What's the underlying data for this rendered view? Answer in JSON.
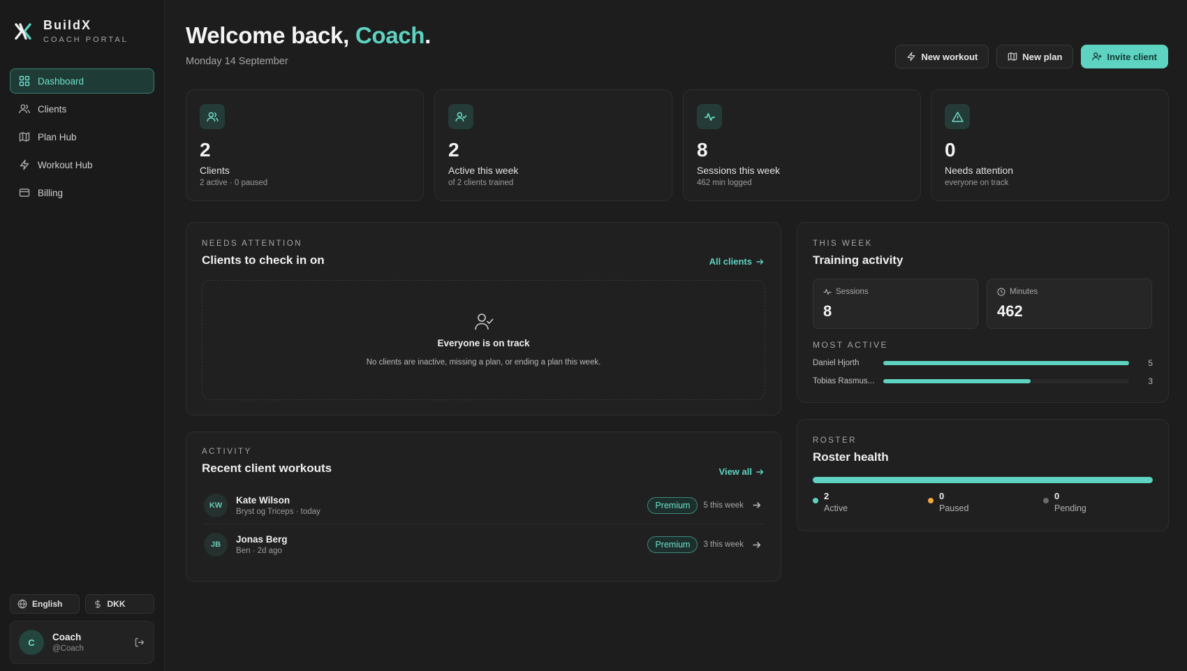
{
  "brand": {
    "name": "BuildX",
    "subtitle": "COACH PORTAL"
  },
  "sidebar": {
    "items": [
      {
        "label": "Dashboard",
        "icon": "grid-icon",
        "active": true
      },
      {
        "label": "Clients",
        "icon": "users-icon"
      },
      {
        "label": "Plan Hub",
        "icon": "map-icon"
      },
      {
        "label": "Workout Hub",
        "icon": "bolt-icon"
      },
      {
        "label": "Billing",
        "icon": "credit-card-icon"
      }
    ],
    "language": "English",
    "currency": "DKK",
    "user": {
      "initial": "C",
      "name": "Coach",
      "handle": "@Coach"
    }
  },
  "header": {
    "greeting": "Welcome back, ",
    "name": "Coach",
    "punct": ".",
    "date": "Monday 14 September",
    "actions": {
      "new_workout": "New workout",
      "new_plan": "New plan",
      "invite_client": "Invite client"
    }
  },
  "stats": [
    {
      "value": "2",
      "label": "Clients",
      "sub": "2 active · 0 paused",
      "icon": "users-icon"
    },
    {
      "value": "2",
      "label": "Active this week",
      "sub": "of 2 clients trained",
      "icon": "user-check-icon"
    },
    {
      "value": "8",
      "label": "Sessions this week",
      "sub": "462 min logged",
      "icon": "activity-icon"
    },
    {
      "value": "0",
      "label": "Needs attention",
      "sub": "everyone on track",
      "icon": "alert-triangle-icon"
    }
  ],
  "attention": {
    "eyebrow": "NEEDS ATTENTION",
    "title": "Clients to check in on",
    "link": "All clients",
    "empty_title": "Everyone is on track",
    "empty_sub": "No clients are inactive, missing a plan, or ending a plan this week."
  },
  "activity": {
    "eyebrow": "ACTIVITY",
    "title": "Recent client workouts",
    "link": "View all",
    "rows": [
      {
        "initials": "KW",
        "name": "Kate Wilson",
        "sub": "Bryst og Triceps · today",
        "badge": "Premium",
        "count": "5 this week"
      },
      {
        "initials": "JB",
        "name": "Jonas Berg",
        "sub": "Ben · 2d ago",
        "badge": "Premium",
        "count": "3 this week"
      }
    ]
  },
  "training": {
    "eyebrow": "THIS WEEK",
    "title": "Training activity",
    "sessions_label": "Sessions",
    "sessions_value": "8",
    "minutes_label": "Minutes",
    "minutes_value": "462",
    "most_active_label": "MOST ACTIVE",
    "most_active": [
      {
        "name": "Daniel Hjorth",
        "value": "5",
        "fraction": 1.0
      },
      {
        "name": "Tobias Rasmus...",
        "value": "3",
        "fraction": 0.6
      }
    ]
  },
  "roster": {
    "eyebrow": "ROSTER",
    "title": "Roster health",
    "active_fraction": 1.0,
    "legend": [
      {
        "value": "2",
        "label": "Active",
        "color": "#5ed3c1"
      },
      {
        "value": "0",
        "label": "Paused",
        "color": "#f0a83a"
      },
      {
        "value": "0",
        "label": "Pending",
        "color": "#6b6b6b"
      }
    ]
  },
  "colors": {
    "accent": "#5ed3c1",
    "background": "#1d1d1d",
    "card": "#202020"
  }
}
